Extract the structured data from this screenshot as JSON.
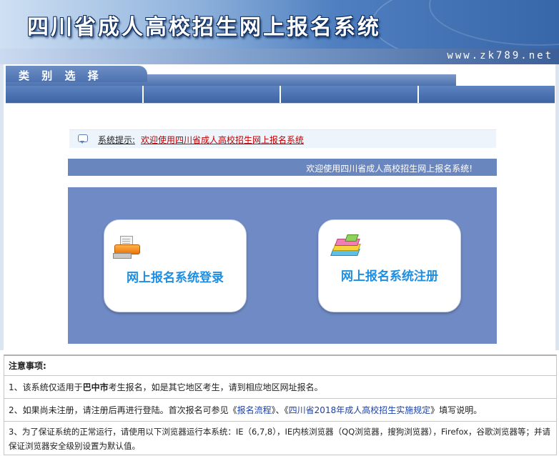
{
  "header": {
    "title": "四川省成人高校招生网上报名系统",
    "url": "www.zk789.net"
  },
  "category": {
    "label": "类 别 选 择"
  },
  "system_tip": {
    "icon": "speech-bubble-icon",
    "label": "系统提示:",
    "message": "欢迎使用四川省成人高校招生网上报名系统"
  },
  "welcome": {
    "text": "欢迎使用四川省成人高校招生网上报名系统!"
  },
  "cards": {
    "login": {
      "icon": "printer-icon",
      "label": "网上报名系统登录"
    },
    "register": {
      "icon": "books-icon",
      "label": "网上报名系统注册"
    }
  },
  "notice": {
    "heading": "注意事项:",
    "item1": {
      "prefix": "1、该系统仅适用于",
      "highlight": "巴中市",
      "suffix": "考生报名，如是其它地区考生，请到相应地区网址报名。"
    },
    "item2": {
      "prefix": "2、如果尚未注册，请注册后再进行登陆。首次报名可参见《",
      "link1": "报名流程",
      "mid": "》、《",
      "link2": "四川省2018年成人高校招生实施规定",
      "suffix": "》填写说明。"
    },
    "item3": {
      "text": "3、为了保证系统的正常运行，请使用以下浏览器运行本系统：IE（6,7,8），IE内核浏览器（QQ浏览器，搜狗浏览器），Firefox，谷歌浏览器等；并请保证浏览器安全级别设置为默认值。"
    }
  },
  "colors": {
    "accent": "#6f8ac4",
    "card_text": "#1e8ee0",
    "tip_message": "#c00000"
  }
}
